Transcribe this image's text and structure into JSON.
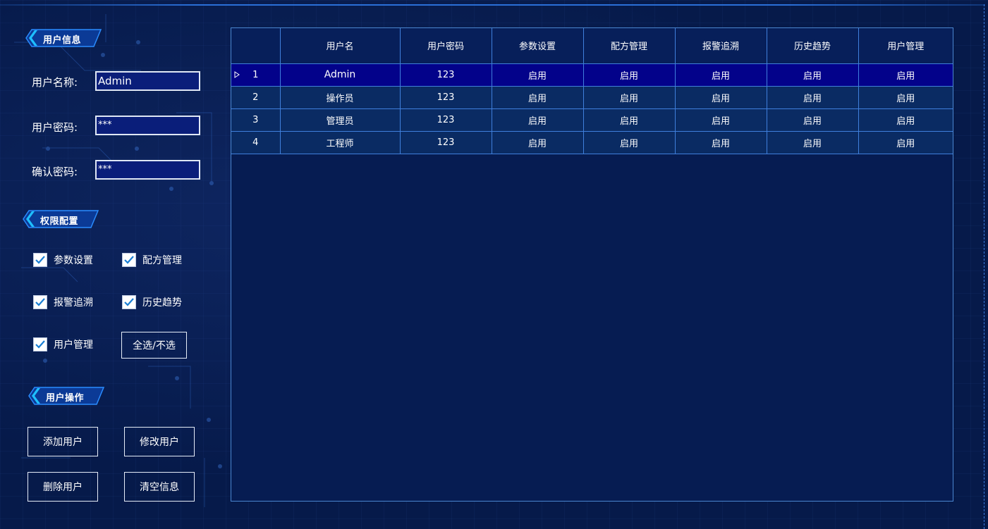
{
  "sections": {
    "user_info": "用户信息",
    "permission": "权限配置",
    "operations": "用户操作"
  },
  "user_form": {
    "username_label": "用户名称:",
    "username_value": "Admin",
    "password_label": "用户密码:",
    "password_value": "***",
    "confirm_label": "确认密码:",
    "confirm_value": "***"
  },
  "permissions": [
    {
      "label": "参数设置",
      "checked": true
    },
    {
      "label": "配方管理",
      "checked": true
    },
    {
      "label": "报警追溯",
      "checked": true
    },
    {
      "label": "历史趋势",
      "checked": true
    },
    {
      "label": "用户管理",
      "checked": true
    }
  ],
  "select_all_label": "全选/不选",
  "actions": {
    "add": "添加用户",
    "modify": "修改用户",
    "delete": "删除用户",
    "clear": "清空信息"
  },
  "table": {
    "columns": [
      "",
      "用户名",
      "用户密码",
      "参数设置",
      "配方管理",
      "报警追溯",
      "历史趋势",
      "用户管理"
    ],
    "rows": [
      [
        "1",
        "Admin",
        "123",
        "启用",
        "启用",
        "启用",
        "启用",
        "启用"
      ],
      [
        "2",
        "操作员",
        "123",
        "启用",
        "启用",
        "启用",
        "启用",
        "启用"
      ],
      [
        "3",
        "管理员",
        "123",
        "启用",
        "启用",
        "启用",
        "启用",
        "启用"
      ],
      [
        "4",
        "工程师",
        "123",
        "启用",
        "启用",
        "启用",
        "启用",
        "启用"
      ]
    ],
    "selected_row": 0
  },
  "colors": {
    "background": "#061a4a",
    "accent_blue": "#1e90ff",
    "grid_border": "#3f7fdc",
    "selected_row": "#03028a",
    "input_bg": "#0a1e7a",
    "check_mark": "#1b7fd4"
  }
}
